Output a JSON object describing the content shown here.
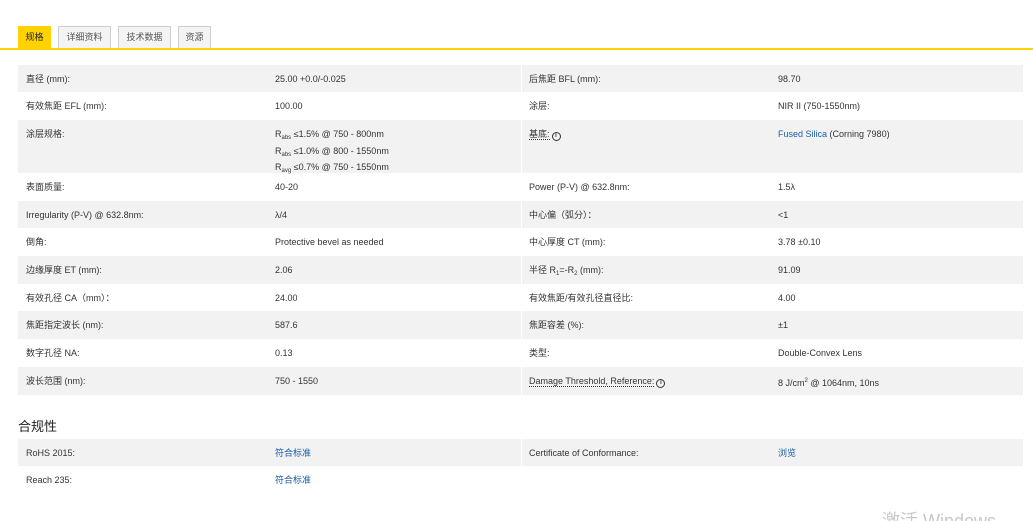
{
  "tabs": [
    {
      "label": "规格",
      "active": true
    },
    {
      "label": "详细资料",
      "active": false
    },
    {
      "label": "技术数据",
      "active": false
    },
    {
      "label": "资源",
      "active": false
    }
  ],
  "specs": {
    "diameter": {
      "label": "直径 (mm):",
      "value": "25.00 +0.0/-0.025"
    },
    "bfl": {
      "label": "后焦距 BFL (mm):",
      "value": "98.70"
    },
    "efl": {
      "label": "有效焦距 EFL (mm):",
      "value": "100.00"
    },
    "coating": {
      "label": "涂层:",
      "value": "NIR II (750-1550nm)"
    },
    "coating_spec": {
      "label": "涂层规格:",
      "line1_sym": "R",
      "line1_sub": "abs",
      "line1_text": " ≤1.5% @ 750 - 800nm",
      "line2_sym": "R",
      "line2_sub": "abs",
      "line2_text": " ≤1.0% @ 800 - 1550nm",
      "line3_sym": "R",
      "line3_sub": "avg",
      "line3_text": " ≤0.7% @ 750 - 1550nm"
    },
    "substrate": {
      "label": "基底:",
      "link": "Fused Silica",
      "extra": " (Corning 7980)"
    },
    "surface_quality": {
      "label": "表面质量:",
      "value": "40-20"
    },
    "power": {
      "label": "Power (P-V) @ 632.8nm:",
      "value": "1.5λ"
    },
    "irregularity": {
      "label": "Irregularity (P-V) @ 632.8nm:",
      "value": "λ/4"
    },
    "centering": {
      "label": "中心偏（弧分）：",
      "value": "<1"
    },
    "bevel": {
      "label": "倒角:",
      "value": "Protective bevel as needed"
    },
    "ct": {
      "label": "中心厚度 CT (mm):",
      "value": "3.78 ±0.10"
    },
    "et": {
      "label": "边缘厚度 ET (mm):",
      "value": "2.06"
    },
    "radius": {
      "label_pre": "半径 R",
      "sub1": "1",
      "label_mid": "=-R",
      "sub2": "2",
      "label_post": " (mm):",
      "value": "91.09"
    },
    "ca": {
      "label": "有效孔径 CA（mm）：",
      "value": "24.00"
    },
    "f_number": {
      "label": "有效焦距/有效孔径直径比:",
      "value": "4.00"
    },
    "design_wavelength": {
      "label": "焦距指定波长 (nm):",
      "value": "587.6"
    },
    "focal_tolerance": {
      "label": "焦距容差 (%):",
      "value": "±1"
    },
    "na": {
      "label": "数字孔径 NA:",
      "value": "0.13"
    },
    "type": {
      "label": "类型:",
      "value": "Double-Convex Lens"
    },
    "wavelength_range": {
      "label": "波长范围 (nm):",
      "value": "750 - 1550"
    },
    "damage": {
      "label": "Damage Threshold, Reference:",
      "value_pre": "8 J/cm",
      "value_sup": "2",
      "value_post": " @ 1064nm, 10ns"
    }
  },
  "compliance": {
    "title": "合规性",
    "rohs": {
      "label": "RoHS 2015:",
      "value": "符合标准"
    },
    "coc": {
      "label": "Certificate of Conformance:",
      "value": "浏览"
    },
    "reach": {
      "label": "Reach 235:",
      "value": "符合标准"
    }
  },
  "watermark": "激活 Windows"
}
